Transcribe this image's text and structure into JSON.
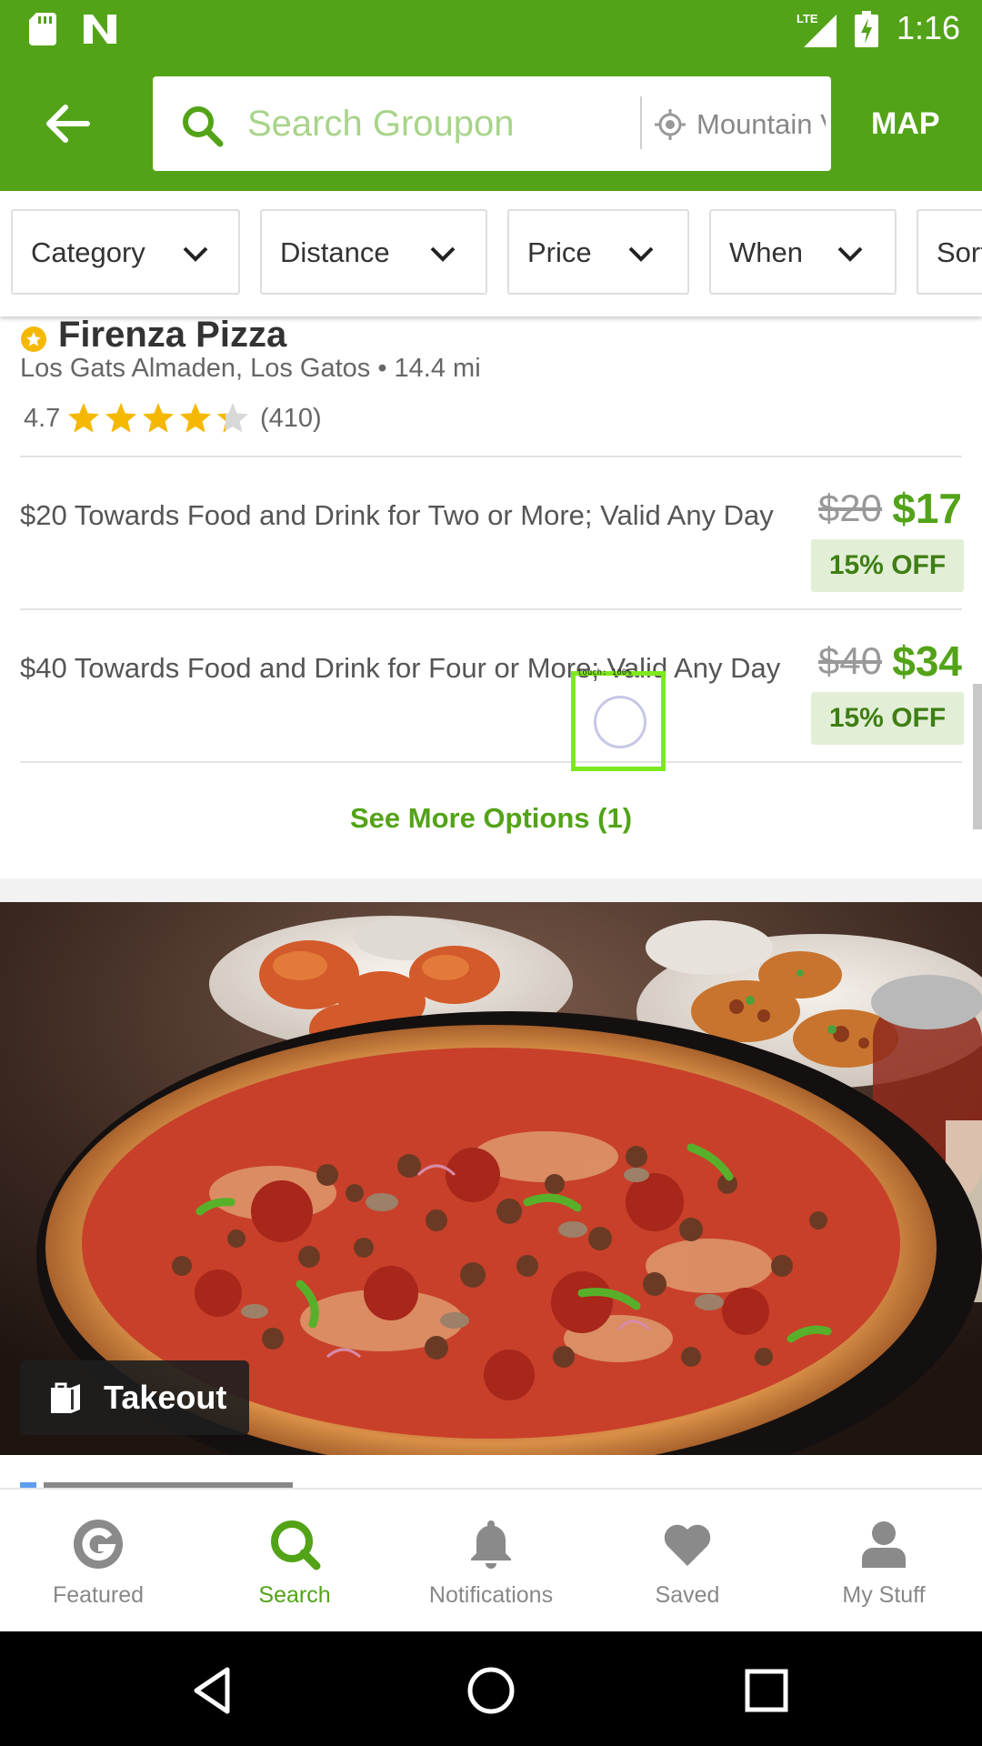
{
  "status_bar": {
    "time": "1:16",
    "network": "LTE"
  },
  "app_bar": {
    "search_placeholder": "Search Groupon",
    "location": "Mountain View",
    "map_label": "MAP"
  },
  "filters": [
    {
      "label": "Category"
    },
    {
      "label": "Distance"
    },
    {
      "label": "Price"
    },
    {
      "label": "When"
    },
    {
      "label": "Sort"
    }
  ],
  "merchant": {
    "name": "Firenza Pizza",
    "location": "Los Gats Almaden, Los Gatos • 14.4 mi",
    "rating": "4.7",
    "rating_stars": 4.7,
    "review_count": "(410)"
  },
  "options": [
    {
      "title": "$20 Towards Food and Drink for Two or More; Valid Any Day",
      "original_price": "$20",
      "sale_price": "$17",
      "discount": "15% OFF"
    },
    {
      "title": "$40 Towards Food and Drink for Four or More; Valid Any Day",
      "original_price": "$40",
      "sale_price": "$34",
      "discount": "15% OFF"
    }
  ],
  "see_more": "See More Options (1)",
  "touch_overlay": "touch: 100%",
  "deal_image": {
    "badge_label": "Takeout"
  },
  "bottom_nav": [
    {
      "label": "Featured",
      "active": false
    },
    {
      "label": "Search",
      "active": true
    },
    {
      "label": "Notifications",
      "active": false
    },
    {
      "label": "Saved",
      "active": false
    },
    {
      "label": "My Stuff",
      "active": false
    }
  ],
  "colors": {
    "brand_green": "#53a318",
    "star_yellow": "#f5b800",
    "discount_bg": "#e2efd6"
  }
}
